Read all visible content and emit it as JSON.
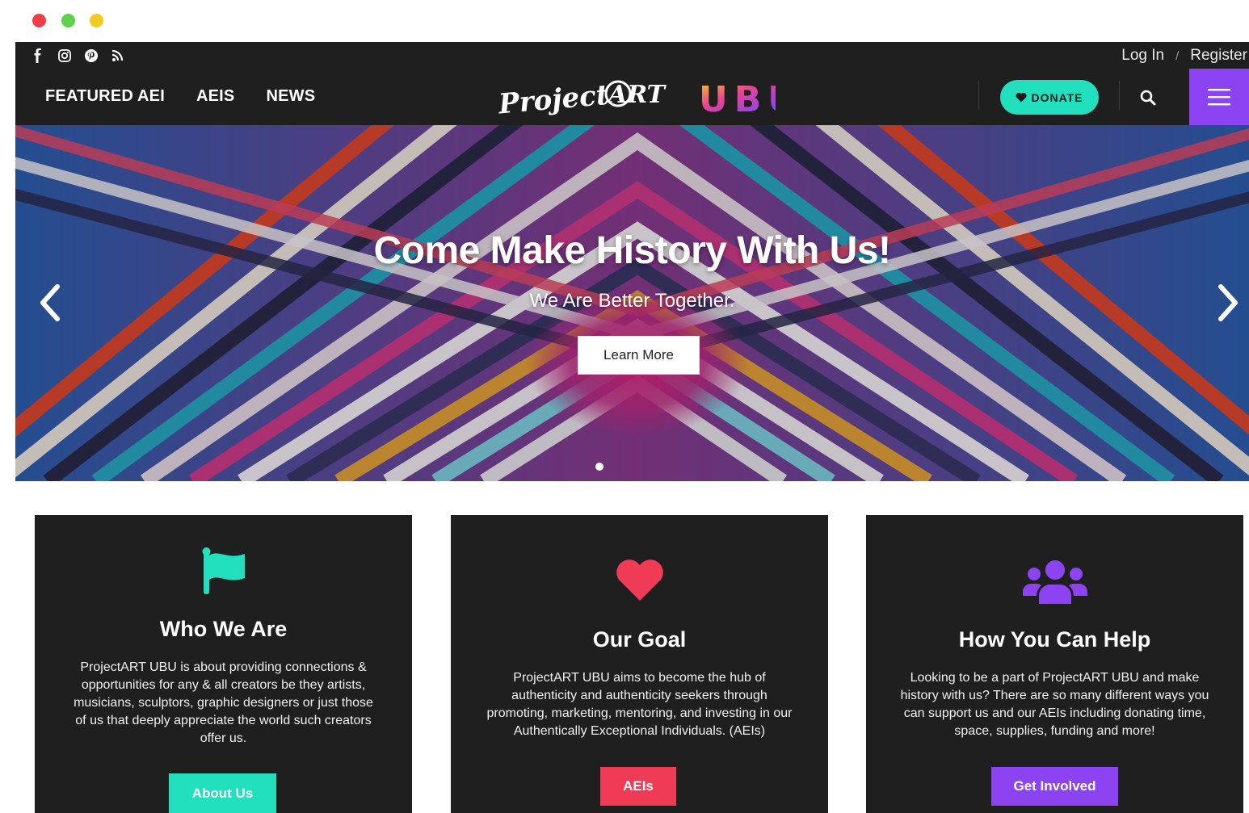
{
  "window": {
    "buttons": [
      "close",
      "minimize",
      "zoom"
    ]
  },
  "header": {
    "social_icons": [
      "facebook-icon",
      "instagram-icon",
      "pinterest-icon",
      "rss-icon"
    ],
    "login": "Log In",
    "separator": "/",
    "register": "Register",
    "nav": [
      "FEATURED AEI",
      "AEIS",
      "NEWS"
    ],
    "logo_text": "Project ART",
    "logo_suffix": "UBU",
    "donate_label": "DONATE",
    "colors": {
      "bar": "#1f1f1f",
      "donate": "#22e0bd",
      "menu": "#8c43f2"
    }
  },
  "hero": {
    "title": "Come Make History With Us!",
    "subtitle": "We Are Better Together.",
    "button": "Learn More",
    "slides": 1,
    "active_slide": 1
  },
  "cards": [
    {
      "icon": "flag-icon",
      "title": "Who We Are",
      "text": "ProjectART UBU is about providing connections & opportunities for any & all creators be they artists, musicians, sculptors, graphic designers or just those of us that deeply appreciate the world such creators offer us.",
      "button": "About Us",
      "color": "#22e0bd"
    },
    {
      "icon": "heart-icon",
      "title": "Our Goal",
      "text": "ProjectART UBU aims to become the hub of authenticity and authenticity seekers through promoting, marketing, mentoring, and investing in our Authentically Exceptional Individuals. (AEIs)",
      "button": "AEIs",
      "color": "#ef3b56"
    },
    {
      "icon": "users-icon",
      "title": "How You Can Help",
      "text": "Looking to be a part of ProjectART UBU and make history with us? There are so many different ways you can support us and our AEIs including donating time, space, supplies, funding and more!",
      "button": "Get Involved",
      "color": "#8c43f2"
    }
  ]
}
